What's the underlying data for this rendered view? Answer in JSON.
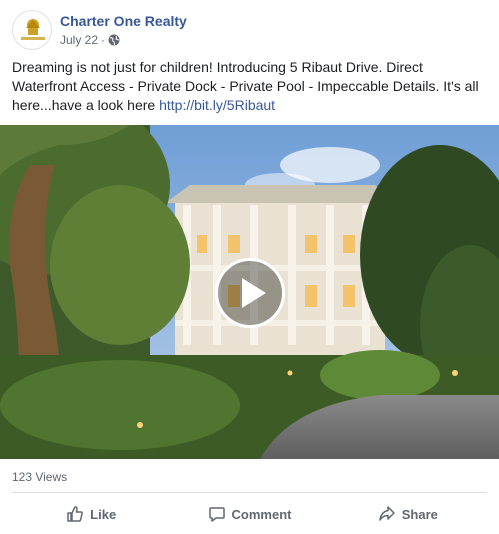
{
  "post": {
    "page_name": "Charter One Realty",
    "date": "July 22",
    "separator": "·",
    "text_main": "Dreaming is not just for children! Introducing 5 Ribaut Drive. Direct Waterfront Access - Private Dock - Private Pool - Impeccable Details. It's all here...have a look here ",
    "link": "http://bit.ly/5Ribaut",
    "avatar_text": "CHARTER ONE REALTY"
  },
  "stats": {
    "views": "123 Views"
  },
  "actions": {
    "like": "Like",
    "comment": "Comment",
    "share": "Share"
  },
  "colors": {
    "link": "#385898",
    "page_name": "#365899",
    "meta": "#606770"
  },
  "icons": [
    "globe-icon",
    "play-icon",
    "like-icon",
    "comment-icon",
    "share-icon"
  ]
}
